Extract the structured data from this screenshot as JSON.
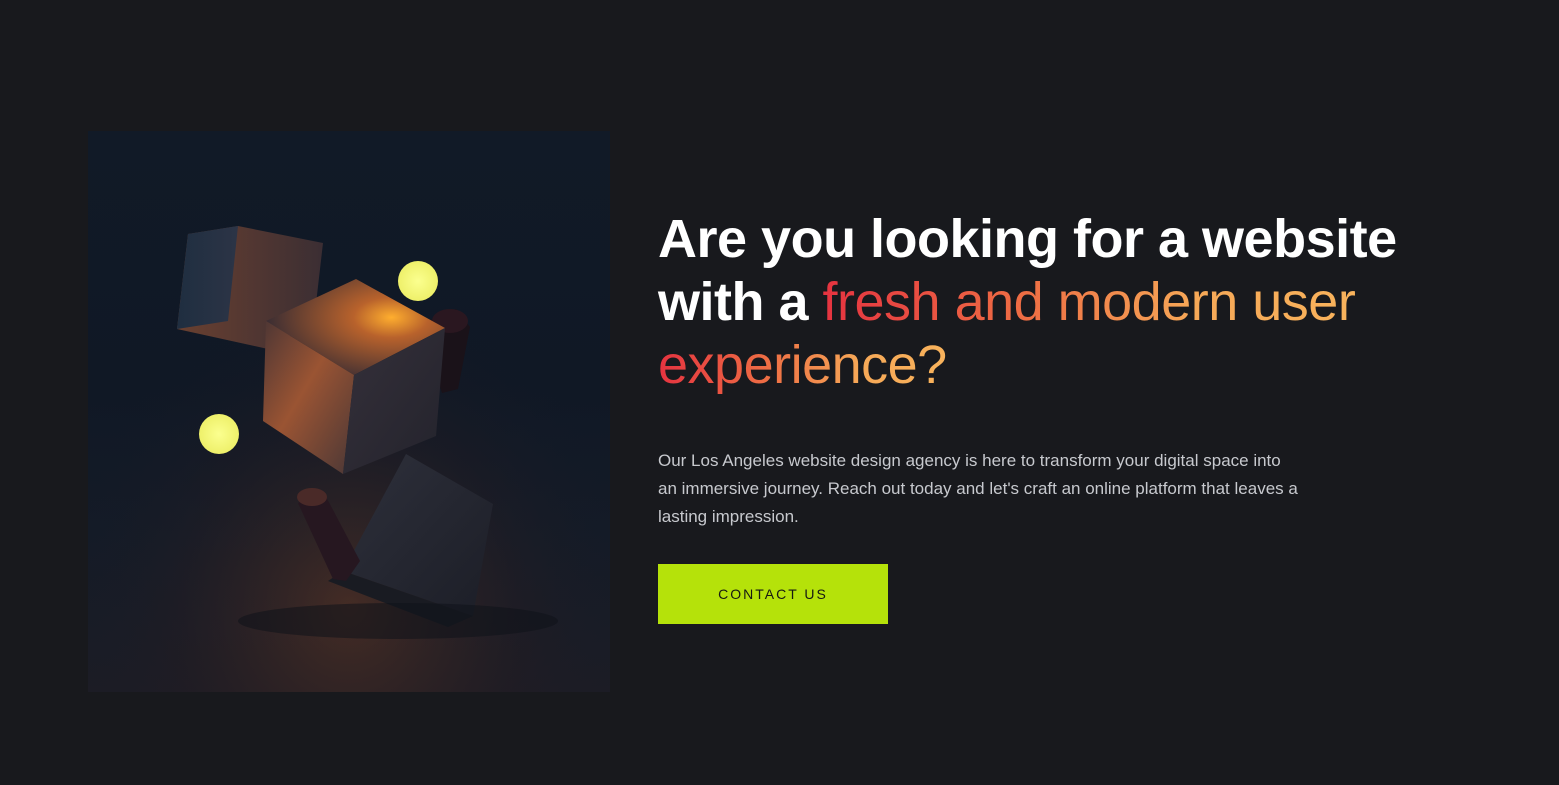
{
  "colors": {
    "background": "#18191d",
    "cta_background": "#b5e20a",
    "cta_text": "#171a12",
    "accent_start": "#e53340",
    "accent_end": "#f8b35c",
    "orb_yellow": "#f2f57a"
  },
  "hero": {
    "image": {
      "description_icon": "floating-cubes-illustration"
    },
    "headline": {
      "line1": "Are you looking for a website",
      "line2_prefix": "with a ",
      "accent": "fresh and modern user experience?"
    },
    "accent_parts": {
      "part1": "fresh and modern user",
      "part2": "experience?"
    },
    "description": "Our Los Angeles website design agency is here to transform your digital space into an immersive journey. Reach out today and let's craft an online platform that leaves a lasting impression.",
    "cta_label": "CONTACT US"
  }
}
